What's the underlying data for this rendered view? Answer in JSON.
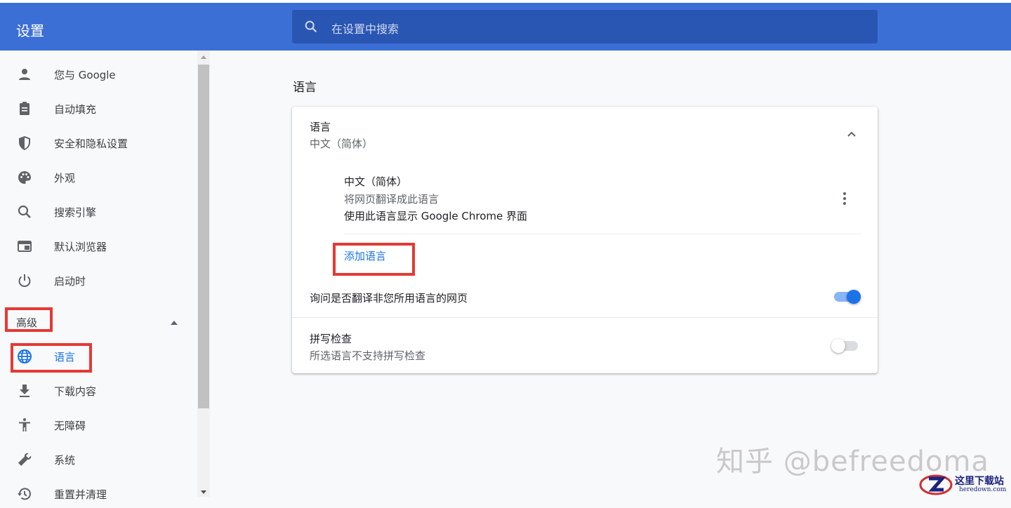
{
  "app": {
    "title": "设置"
  },
  "search": {
    "placeholder": "在设置中搜索"
  },
  "sidebar": {
    "items": [
      {
        "label": "您与 Google",
        "icon": "person-icon"
      },
      {
        "label": "自动填充",
        "icon": "clipboard-icon"
      },
      {
        "label": "安全和隐私设置",
        "icon": "shield-icon"
      },
      {
        "label": "外观",
        "icon": "palette-icon"
      },
      {
        "label": "搜索引擎",
        "icon": "search-icon"
      },
      {
        "label": "默认浏览器",
        "icon": "browser-window-icon"
      },
      {
        "label": "启动时",
        "icon": "power-icon"
      }
    ],
    "advanced_label": "高级",
    "advanced_items": [
      {
        "label": "语言",
        "icon": "globe-icon",
        "active": true
      },
      {
        "label": "下载内容",
        "icon": "download-icon"
      },
      {
        "label": "无障碍",
        "icon": "accessibility-icon"
      },
      {
        "label": "系统",
        "icon": "wrench-icon"
      },
      {
        "label": "重置并清理",
        "icon": "history-icon"
      }
    ]
  },
  "main": {
    "section_title": "语言",
    "languages_card": {
      "title": "语言",
      "subtitle": "中文（简体）",
      "entry": {
        "name": "中文（简体）",
        "line1": "将网页翻译成此语言",
        "line2": "使用此语言显示 Google Chrome 界面"
      },
      "add_language": "添加语言",
      "offer_translate": {
        "label": "询问是否翻译非您所用语言的网页",
        "enabled": true
      }
    },
    "spellcheck": {
      "title": "拼写检查",
      "subtitle": "所选语言不支持拼写检查",
      "enabled": false
    }
  },
  "watermark": {
    "text": "知乎 @befreedoma"
  },
  "site_badge": {
    "name": "这里下载站",
    "url": "heredown.com"
  },
  "colors": {
    "header": "#3c6fd6",
    "search_bg": "#2a56b3",
    "accent": "#1a73e8",
    "highlight": "#e53935"
  }
}
